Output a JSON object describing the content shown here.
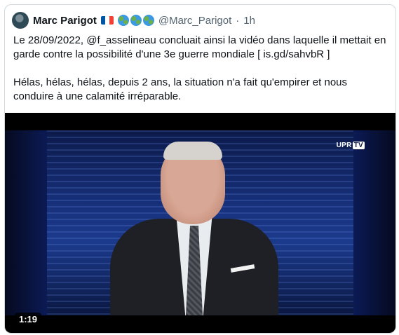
{
  "author": {
    "name": "Marc Parigot",
    "handle": "@Marc_Parigot",
    "separator": "·",
    "time": "1h",
    "flag_colors": [
      "#0055a4",
      "#ffffff",
      "#ef4135"
    ],
    "globe_count": 3
  },
  "tweet": {
    "paragraphs": [
      "Le 28/09/2022, @f_asselineau concluait ainsi la vidéo dans laquelle il mettait en garde contre la possibilité d'une 3e guerre mondiale [ is.gd/sahvbR ]",
      "Hélas, hélas, hélas, depuis 2 ans, la situation n'a fait qu'empirer et nous conduire à une calamité irréparable."
    ]
  },
  "video": {
    "logo_prefix": "UPR",
    "logo_suffix": "TV",
    "duration": "1:19"
  }
}
